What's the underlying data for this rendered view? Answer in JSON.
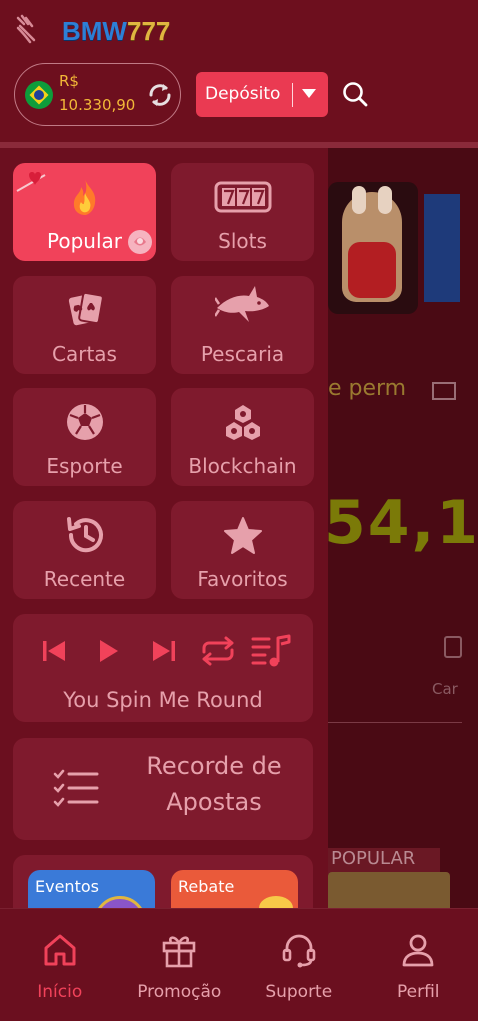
{
  "header": {
    "logo_part1": "BMW",
    "logo_part2": "777",
    "balance_currency": "R$",
    "balance_amount": "10.330,90",
    "deposit_label": "Depósito",
    "flag_icon": "brazil-flag-icon",
    "refresh_icon": "refresh-icon",
    "search_icon": "search-icon"
  },
  "menu": {
    "tiles": [
      {
        "label": "Popular",
        "icon": "flame-icon",
        "active": true
      },
      {
        "label": "Slots",
        "icon": "slot-777-icon",
        "active": false
      },
      {
        "label": "Cartas",
        "icon": "cards-icon",
        "active": false
      },
      {
        "label": "Pescaria",
        "icon": "shark-icon",
        "active": false
      },
      {
        "label": "Esporte",
        "icon": "soccer-ball-icon",
        "active": false
      },
      {
        "label": "Blockchain",
        "icon": "blockchain-icon",
        "active": false
      },
      {
        "label": "Recente",
        "icon": "history-icon",
        "active": false
      },
      {
        "label": "Favoritos",
        "icon": "star-icon",
        "active": false
      }
    ],
    "music": {
      "title": "You Spin Me Round",
      "controls": [
        "previous-icon",
        "play-icon",
        "next-icon",
        "repeat-icon",
        "playlist-icon"
      ]
    },
    "record": {
      "line1": "Recorde de",
      "line2": "Apostas",
      "icon": "checklist-icon"
    },
    "promos": [
      {
        "label": "Eventos"
      },
      {
        "label": "Rebate"
      }
    ]
  },
  "background": {
    "marquee_text": "e perm",
    "jackpot_text": "54,1",
    "category_partial": "Car",
    "popular_tag": "POPULAR"
  },
  "bottom_nav": {
    "items": [
      {
        "label": "Início",
        "icon": "home-icon",
        "active": true
      },
      {
        "label": "Promoção",
        "icon": "gift-icon",
        "active": false
      },
      {
        "label": "Suporte",
        "icon": "headset-icon",
        "active": false
      },
      {
        "label": "Perfil",
        "icon": "user-icon",
        "active": false
      }
    ]
  },
  "colors": {
    "background": "#6b0f1f",
    "tile": "#7f1a2d",
    "accent": "#f1425a",
    "gold": "#f2b838",
    "muted_text": "#e6a0ab"
  }
}
